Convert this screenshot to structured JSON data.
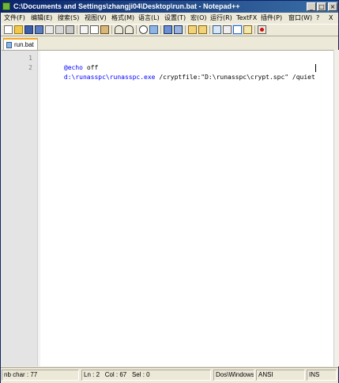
{
  "window": {
    "title": "C:\\Documents and Settings\\zhangji04\\Desktop\\run.bat - Notepad++",
    "controls": {
      "minimize": "_",
      "maximize": "□",
      "close": "×"
    }
  },
  "menu": {
    "items": [
      "文件(F)",
      "编辑(E)",
      "搜索(S)",
      "视图(V)",
      "格式(M)",
      "语言(L)",
      "设置(T)",
      "宏(O)",
      "运行(R)",
      "TextFX",
      "插件(P)",
      "窗口(W)",
      "?"
    ],
    "close": "X"
  },
  "toolbar": {
    "icons": [
      "new-file-icon",
      "open-file-icon",
      "save-icon",
      "save-all-icon",
      "close-file-icon",
      "close-all-icon",
      "print-icon",
      "cut-icon",
      "copy-icon",
      "paste-icon",
      "undo-icon",
      "redo-icon",
      "find-icon",
      "replace-icon",
      "zoom-in-icon",
      "zoom-out-icon",
      "sync-vertical-icon",
      "sync-horizontal-icon",
      "word-wrap-icon",
      "show-all-chars-icon",
      "indent-guide-icon",
      "user-language-icon",
      "record-macro-icon"
    ]
  },
  "tabs": [
    {
      "label": "run.bat",
      "active": true
    }
  ],
  "editor": {
    "lines": [
      {
        "number": "1",
        "parts": [
          {
            "text": "@echo",
            "style": "kw"
          },
          {
            "text": " off",
            "style": "txt"
          }
        ]
      },
      {
        "number": "2",
        "parts": [
          {
            "text": "d:\\runasspc\\runasspc.exe",
            "style": "kw"
          },
          {
            "text": " /cryptfile:\"D:\\runasspc\\crypt.spc\" /quiet",
            "style": "txt"
          }
        ]
      }
    ],
    "current_line_highlight": "#e8e8ff"
  },
  "status": {
    "nb_char": "nb char : 77",
    "ln": "Ln : 2",
    "col": "Col : 67",
    "sel": "Sel : 0",
    "eol": "Dos\\Windows",
    "encoding": "ANSI",
    "mode": "INS"
  },
  "colors": {
    "title_gradient_start": "#0a246a",
    "title_gradient_end": "#3a6ea5",
    "keyword": "#0000ff",
    "tab_accent": "#f5a623"
  }
}
